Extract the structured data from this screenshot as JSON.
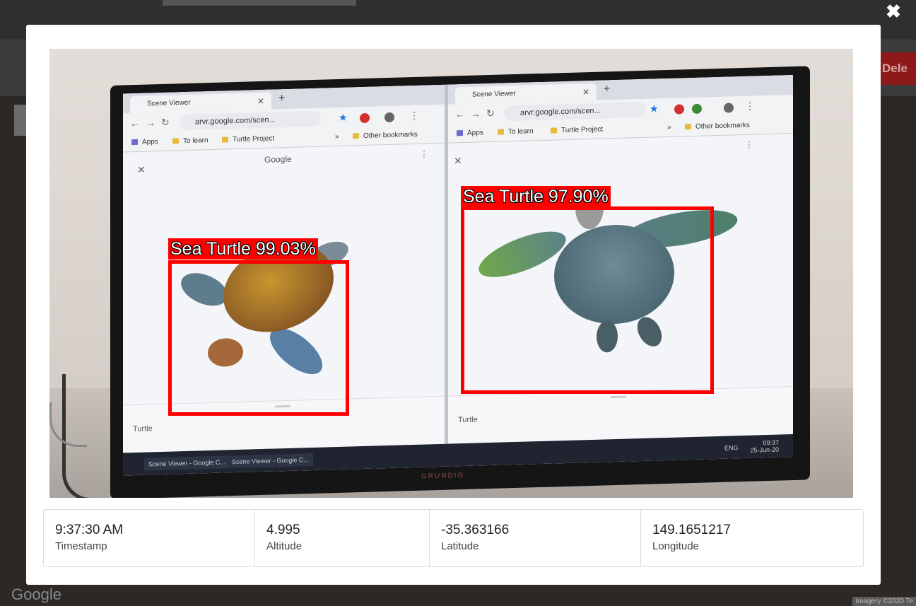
{
  "background": {
    "delete_label": "Dele",
    "google_watermark": "Google",
    "attribution": "Imagery ©2020  Te"
  },
  "overlay": {
    "close_glyph": "✖"
  },
  "photo": {
    "left_window": {
      "tab_title": "Scene Viewer",
      "omnibox": "arvr.google.com/scen...",
      "bookmarks": [
        "Apps",
        "To learn",
        "Turtle Project",
        "»",
        "Other bookmarks"
      ],
      "page_brand": "Google",
      "footer_label": "Turtle"
    },
    "right_window": {
      "tab_title": "Scene Viewer",
      "omnibox": "arvr.google.com/scen...",
      "bookmarks": [
        "Apps",
        "To learn",
        "Turtle Project",
        "»",
        "Other bookmarks"
      ],
      "footer_label": "Turtle"
    },
    "taskbar": {
      "items": [
        "Scene Viewer - Google C...",
        "Scene Viewer - Google C..."
      ],
      "lang": "ENG",
      "time": "09:37",
      "date": "25-Jun-20"
    },
    "monitor_brand": "GRUNDIG",
    "detections": [
      {
        "label": "Sea Turtle 99.03%",
        "class": "Sea Turtle",
        "confidence": 99.03
      },
      {
        "label": "Sea Turtle 97.90%",
        "class": "Sea Turtle",
        "confidence": 97.9
      }
    ]
  },
  "info": [
    {
      "value": "9:37:30 AM",
      "label": "Timestamp"
    },
    {
      "value": "4.995",
      "label": "Altitude"
    },
    {
      "value": "-35.363166",
      "label": "Latitude"
    },
    {
      "value": "149.1651217",
      "label": "Longitude"
    }
  ]
}
